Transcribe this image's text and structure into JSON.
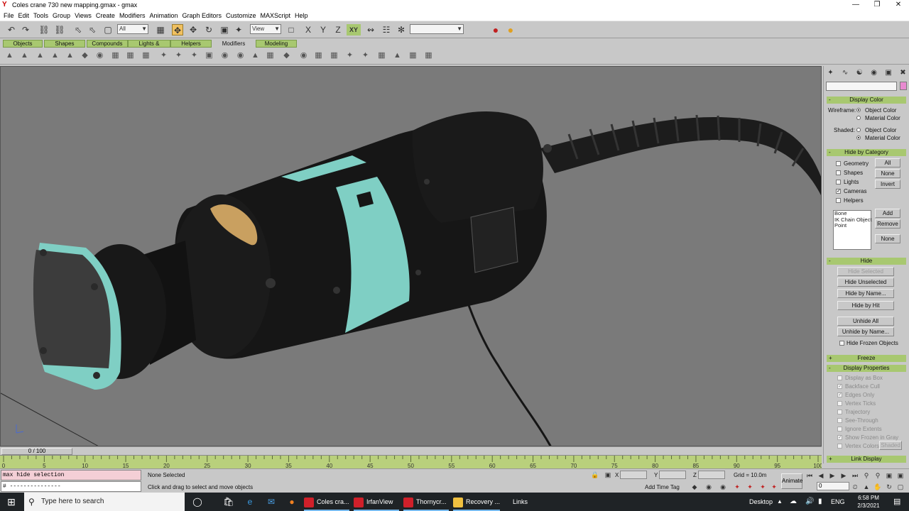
{
  "window": {
    "title": "Coles crane 730 new mapping.gmax - gmax",
    "controls": [
      "minimize-icon",
      "restore-icon",
      "close-icon"
    ]
  },
  "menu": [
    "File",
    "Edit",
    "Tools",
    "Group",
    "Views",
    "Create",
    "Modifiers",
    "Animation",
    "Graph Editors",
    "Customize",
    "MAXScript",
    "Help"
  ],
  "toolbar": {
    "selection_filter": "All",
    "reference_coord": "View",
    "axis_constraint": "XY",
    "named_selection": ""
  },
  "tabs": [
    "Objects",
    "Shapes",
    "Compounds",
    "Lights & Cameras",
    "Helpers",
    "Modifiers",
    "Modeling"
  ],
  "active_tab": "Modifiers",
  "command_panel": {
    "name_field": "",
    "display_color": {
      "title": "Display Color",
      "wireframe_label": "Wireframe:",
      "shaded_label": "Shaded:",
      "object_color": "Object Color",
      "material_color": "Material Color"
    },
    "hide_by_category": {
      "title": "Hide by Category",
      "items": [
        {
          "label": "Geometry",
          "checked": false
        },
        {
          "label": "Shapes",
          "checked": false
        },
        {
          "label": "Lights",
          "checked": false
        },
        {
          "label": "Cameras",
          "checked": true
        },
        {
          "label": "Helpers",
          "checked": false
        }
      ],
      "all_button": "All",
      "none_button": "None",
      "invert_button": "Invert",
      "list": [
        "Bone",
        "IK Chain Object",
        "Point"
      ],
      "add_button": "Add",
      "remove_button": "Remove",
      "list_none_button": "None"
    },
    "hide": {
      "title": "Hide",
      "hide_selected": "Hide Selected",
      "hide_unselected": "Hide Unselected",
      "hide_by_name": "Hide by Name...",
      "hide_by_hit": "Hide by Hit",
      "unhide_all": "Unhide All",
      "unhide_by_name": "Unhide by Name...",
      "hide_frozen": "Hide Frozen Objects"
    },
    "freeze": {
      "title": "Freeze"
    },
    "display_properties": {
      "title": "Display Properties",
      "items": [
        {
          "label": "Display as Box",
          "checked": false
        },
        {
          "label": "Backface Cull",
          "checked": true
        },
        {
          "label": "Edges Only",
          "checked": true
        },
        {
          "label": "Vertex Ticks",
          "checked": false
        },
        {
          "label": "Trajectory",
          "checked": false
        },
        {
          "label": "See-Through",
          "checked": false
        },
        {
          "label": "Ignore Extents",
          "checked": false
        },
        {
          "label": "Show Frozen in Gray",
          "checked": true
        },
        {
          "label": "Vertex Colors",
          "checked": false
        }
      ],
      "shaded_button": "Shaded"
    },
    "link_display": {
      "title": "Link Display"
    }
  },
  "timeline": {
    "slider_label": "0 / 100",
    "ticks": [
      0,
      5,
      10,
      15,
      20,
      25,
      30,
      35,
      40,
      45,
      50,
      55,
      60,
      65,
      70,
      75,
      80,
      85,
      90,
      95,
      100
    ]
  },
  "status": {
    "listener_input": "max hide selection",
    "listener_output": "# ---------------",
    "selection": "None Selected",
    "prompt": "Click and drag to select and move objects",
    "x_label": "X",
    "y_label": "Y",
    "z_label": "Z",
    "grid": "Grid = 10.0m",
    "add_time_tag": "Add Time Tag",
    "animate": "Animate",
    "frame": "0"
  },
  "taskbar": {
    "search_placeholder": "Type here to search",
    "apps": [
      {
        "label": "Coles cra...",
        "color": "#d0202a",
        "running": true
      },
      {
        "label": "IrfanView",
        "color": "#d0202a",
        "running": true
      },
      {
        "label": "Thornycr...",
        "color": "#d0202a",
        "running": true
      },
      {
        "label": "Recovery ...",
        "color": "#f0c040",
        "running": true
      }
    ],
    "links": "Links",
    "desktop": "Desktop",
    "language": "ENG",
    "time": "6:58 PM",
    "date": "2/3/2021"
  },
  "colors": {
    "viewport_bg": "#7a7a7a",
    "rollout_green": "#a8c870",
    "trackbar_green": "#b9d07c",
    "object_body": "#141414",
    "object_accent": "#7fcfc4",
    "object_tan": "#c9a060"
  }
}
